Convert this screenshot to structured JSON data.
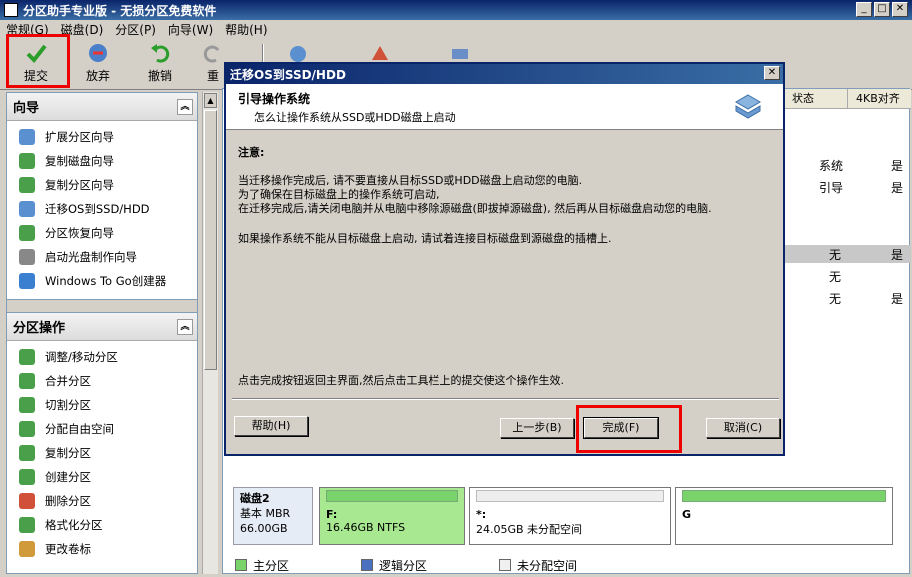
{
  "window": {
    "title": "分区助手专业版 - 无损分区免费软件"
  },
  "menu": [
    "常规(G)",
    "磁盘(D)",
    "分区(P)",
    "向导(W)",
    "帮助(H)"
  ],
  "toolbar": {
    "submit": "提交",
    "discard": "放弃",
    "undo": "撤销",
    "redo": "重"
  },
  "wizard_panel": {
    "title": "向导",
    "items": [
      "扩展分区向导",
      "复制磁盘向导",
      "复制分区向导",
      "迁移OS到SSD/HDD",
      "分区恢复向导",
      "启动光盘制作向导",
      "Windows To Go创建器"
    ]
  },
  "ops_panel": {
    "title": "分区操作",
    "items": [
      "调整/移动分区",
      "合并分区",
      "切割分区",
      "分配自由空间",
      "复制分区",
      "创建分区",
      "删除分区",
      "格式化分区",
      "更改卷标"
    ]
  },
  "table": {
    "headers": [
      "状态",
      "4KB对齐"
    ],
    "rows": [
      {
        "status": "系统",
        "align": "是"
      },
      {
        "status": "引导",
        "align": "是"
      },
      {
        "status": "无",
        "align": "是"
      },
      {
        "status": "无",
        "align": ""
      },
      {
        "status": "无",
        "align": "是"
      }
    ]
  },
  "disk2": {
    "name": "磁盘2",
    "type": "基本 MBR",
    "size": "66.00GB",
    "partitions": [
      {
        "label": "F:",
        "info": "16.46GB NTFS"
      },
      {
        "label": "*:",
        "info": "24.05GB 未分配空间"
      },
      {
        "label": "G",
        "info": ""
      }
    ]
  },
  "legend": [
    "主分区",
    "逻辑分区",
    "未分配空间"
  ],
  "dialog": {
    "title": "迁移OS到SSD/HDD",
    "header_title": "引导操作系统",
    "header_sub": "怎么让操作系统从SSD或HDD磁盘上启动",
    "note_label": "注意:",
    "lines": [
      "当迁移操作完成后, 请不要直接从目标SSD或HDD磁盘上启动您的电脑.",
      "为了确保在目标磁盘上的操作系统可启动,",
      "在迁移完成后,请关闭电脑并从电脑中移除源磁盘(即拔掉源磁盘), 然后再从目标磁盘启动您的电脑."
    ],
    "line2": "如果操作系统不能从目标磁盘上启动, 请试着连接目标磁盘到源磁盘的插槽上.",
    "footer": "点击完成按钮返回主界面,然后点击工具栏上的提交使这个操作生效.",
    "buttons": {
      "help": "帮助(H)",
      "back": "上一步(B)",
      "finish": "完成(F)",
      "cancel": "取消(C)"
    }
  },
  "colors": {
    "highlight": "#e00000",
    "primary_partition": "#7ad36a",
    "title_bar": "#0a246a"
  }
}
